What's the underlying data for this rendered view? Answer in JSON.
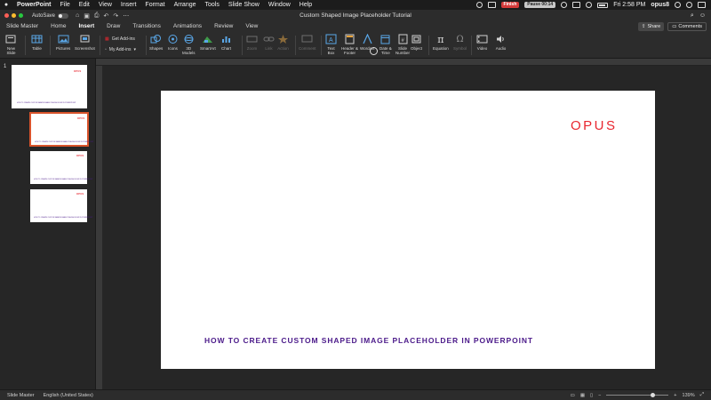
{
  "menubar": {
    "apple": "",
    "items": [
      "PowerPoint",
      "File",
      "Edit",
      "View",
      "Insert",
      "Format",
      "Arrange",
      "Tools",
      "Slide Show",
      "Window",
      "Help"
    ],
    "finish_badge": "Finish",
    "pause_badge": "Pause 00:14",
    "time": "Fri 2:58 PM",
    "user": "opus8"
  },
  "titlebar": {
    "autosave_label": "AutoSave",
    "autosave_state": "OFF",
    "doc_title": "Custom Shaped Image Placeholder Tutorial"
  },
  "ribbon_tabs": {
    "tabs": [
      "Slide Master",
      "Home",
      "Insert",
      "Draw",
      "Transitions",
      "Animations",
      "Review",
      "View"
    ],
    "active": "Insert",
    "share": "Share",
    "comments": "Comments"
  },
  "ribbon": {
    "new_slide": "New\nSlide",
    "table": "Table",
    "pictures": "Pictures",
    "screenshot": "Screenshot",
    "get_addins": "Get Add-ins",
    "my_addins": "My Add-ins",
    "shapes": "Shapes",
    "icons": "Icons",
    "models3d": "3D\nModels",
    "smartart": "SmartArt",
    "chart": "Chart",
    "zoom": "Zoom",
    "link": "Link",
    "action": "Action",
    "comment": "Comment",
    "textbox": "Text\nBox",
    "header_footer": "Header &\nFooter",
    "wordart": "WordArt",
    "date_time": "Date &\nTime",
    "slide_number": "Slide\nNumber",
    "object": "Object",
    "equation": "Equation",
    "symbol": "Symbol",
    "video": "Video",
    "audio": "Audio"
  },
  "sidebar": {
    "slide_number": "1",
    "thumb_logo": "OPUS",
    "thumb_title": "HOW TO CREATE CUSTOM SHAPED IMAGE PLACEHOLDER IN POWERPOINT"
  },
  "slide": {
    "logo": "OPUS",
    "title": "HOW TO CREATE CUSTOM SHAPED IMAGE PLACEHOLDER IN POWERPOINT"
  },
  "statusbar": {
    "view": "Slide Master",
    "language": "English (United States)",
    "zoom": "139%"
  },
  "colors": {
    "brand_red": "#e8262f",
    "title_purple": "#4b1a8a",
    "selected_thumb_border": "#d9532b"
  }
}
